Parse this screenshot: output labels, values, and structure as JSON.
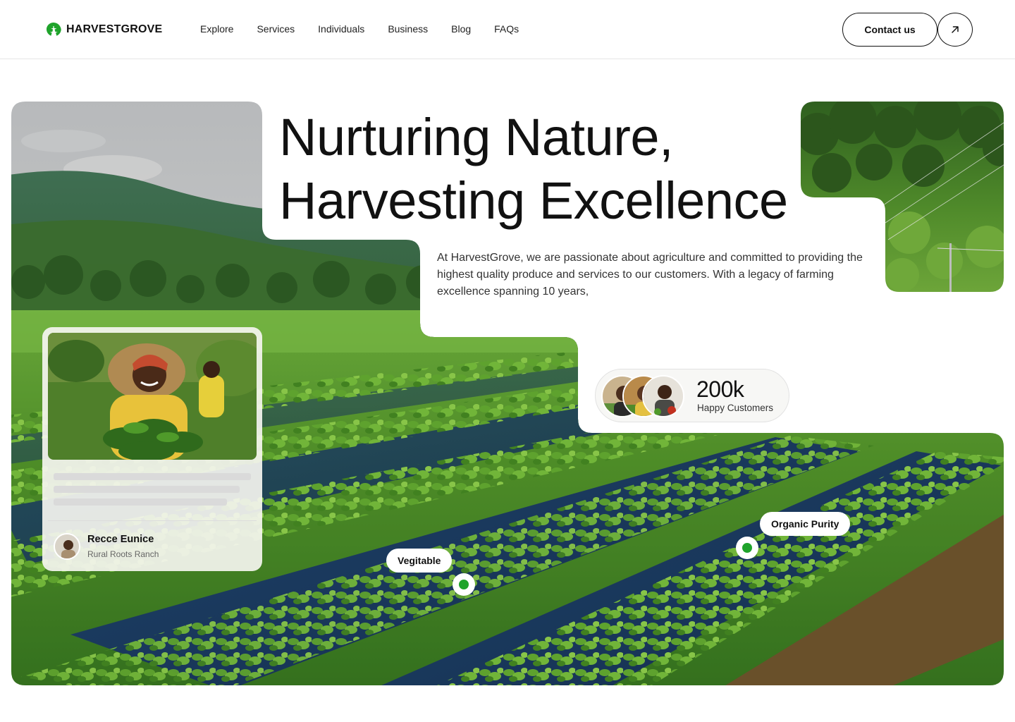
{
  "brand": {
    "name": "HARVESTGROVE",
    "logo_icon": "monstera-leaf-icon",
    "accent_color": "#1fa32b"
  },
  "nav": {
    "links": [
      "Explore",
      "Services",
      "Individuals",
      "Business",
      "Blog",
      "FAQs"
    ],
    "contact_label": "Contact us",
    "contact_icon": "arrow-up-right-icon"
  },
  "hero": {
    "title_line1": "Nurturing Nature,",
    "title_line2": "Harvesting Excellence",
    "description": "At HarvestGrove, we are passionate about agriculture and committed to providing the highest quality produce and services to our customers. With a legacy of farming excellence spanning 10 years,"
  },
  "stats": {
    "count": "200k",
    "label": "Happy Customers"
  },
  "profile_card": {
    "name": "Recce Eunice",
    "farm": "Rural Roots Ranch"
  },
  "tags": {
    "vegetable": "Vegitable",
    "organic": "Organic Purity"
  }
}
